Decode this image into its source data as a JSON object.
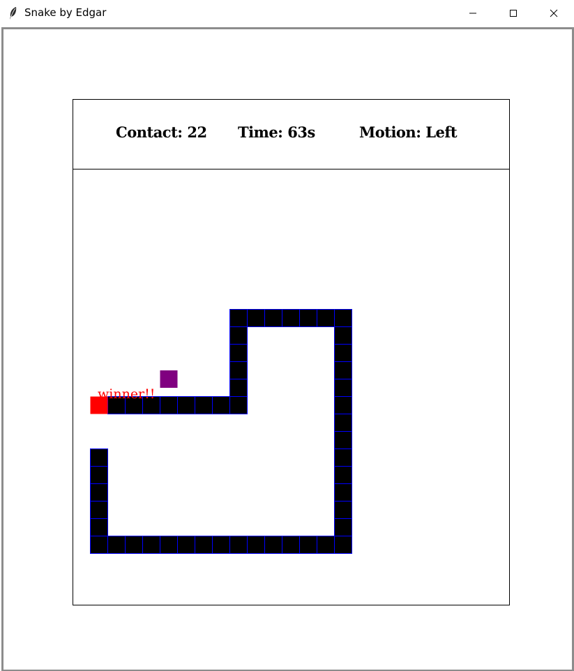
{
  "window": {
    "title": "Snake by Edgar",
    "icon": "feather-icon",
    "controls": [
      "minimize-icon",
      "maximize-icon",
      "close-icon"
    ]
  },
  "scoreboard": {
    "contact": "Contact: 22",
    "time": "Time: 63s",
    "motion": "Motion: Left"
  },
  "game": {
    "message": "winner!!",
    "colors": {
      "snake_body": "#000000",
      "snake_outline": "#0000ff",
      "snake_head": "#ff0000",
      "food": "#800080",
      "message": "#ff0000"
    },
    "head": {
      "col": 0,
      "row": 13
    },
    "food": {
      "col": 4,
      "row": 11.5
    },
    "body": [
      [
        1,
        13
      ],
      [
        2,
        13
      ],
      [
        3,
        13
      ],
      [
        4,
        13
      ],
      [
        5,
        13
      ],
      [
        6,
        13
      ],
      [
        7,
        13
      ],
      [
        8,
        13
      ],
      [
        8,
        12
      ],
      [
        8,
        11
      ],
      [
        8,
        10
      ],
      [
        8,
        9
      ],
      [
        8,
        8
      ],
      [
        9,
        8
      ],
      [
        10,
        8
      ],
      [
        11,
        8
      ],
      [
        12,
        8
      ],
      [
        13,
        8
      ],
      [
        14,
        8
      ],
      [
        14,
        9
      ],
      [
        14,
        10
      ],
      [
        14,
        11
      ],
      [
        14,
        12
      ],
      [
        14,
        13
      ],
      [
        14,
        14
      ],
      [
        14,
        15
      ],
      [
        14,
        16
      ],
      [
        14,
        17
      ],
      [
        14,
        18
      ],
      [
        14,
        19
      ],
      [
        14,
        20
      ],
      [
        14,
        21
      ],
      [
        13,
        21
      ],
      [
        12,
        21
      ],
      [
        11,
        21
      ],
      [
        10,
        21
      ],
      [
        9,
        21
      ],
      [
        8,
        21
      ],
      [
        7,
        21
      ],
      [
        6,
        21
      ],
      [
        5,
        21
      ],
      [
        4,
        21
      ],
      [
        3,
        21
      ],
      [
        2,
        21
      ],
      [
        1,
        21
      ],
      [
        0,
        21
      ],
      [
        0,
        20
      ],
      [
        0,
        19
      ],
      [
        0,
        18
      ],
      [
        0,
        17
      ],
      [
        0,
        16
      ]
    ]
  }
}
